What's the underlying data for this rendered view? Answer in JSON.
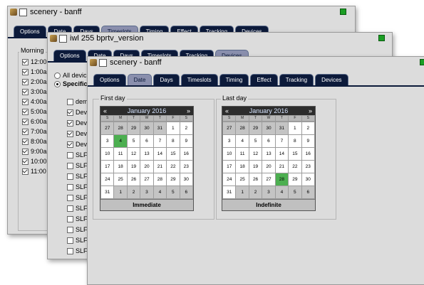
{
  "window1": {
    "title": "scenery - banff",
    "tabs": [
      "Options",
      "Date",
      "Days",
      "Timeslots",
      "Timing",
      "Effect",
      "Tracking",
      "Devices"
    ],
    "active_tab": 3,
    "group_label": "Morning",
    "times": [
      "12:00",
      "1:00a",
      "2:00a",
      "3:00a",
      "4:00a",
      "5:00a",
      "6:00a",
      "7:00a",
      "8:00a",
      "9:00a",
      "10:00",
      "11:00"
    ]
  },
  "window2": {
    "title": "iwl 255 bprtv_version",
    "tabs": [
      "Options",
      "Date",
      "Days",
      "Timeslots",
      "Tracking",
      "Devices"
    ],
    "active_tab": 5,
    "radio_all": "All devic",
    "radio_specific": "Specific",
    "devices": [
      {
        "label": "dem",
        "checked": false
      },
      {
        "label": "Dev",
        "checked": true
      },
      {
        "label": "Dev",
        "checked": true
      },
      {
        "label": "Dev",
        "checked": true
      },
      {
        "label": "Dev",
        "checked": true
      },
      {
        "label": "SLF",
        "checked": false
      },
      {
        "label": "SLF",
        "checked": false
      },
      {
        "label": "SLF",
        "checked": false
      },
      {
        "label": "SLF",
        "checked": false
      },
      {
        "label": "SLF",
        "checked": false
      },
      {
        "label": "SLF",
        "checked": false
      },
      {
        "label": "SLF",
        "checked": false
      },
      {
        "label": "SLF",
        "checked": false
      },
      {
        "label": "SLF",
        "checked": false
      },
      {
        "label": "SLF",
        "checked": false
      }
    ]
  },
  "window3": {
    "title": "scenery - banff",
    "tabs": [
      "Options",
      "Date",
      "Days",
      "Timeslots",
      "Timing",
      "Effect",
      "Tracking",
      "Devices"
    ],
    "active_tab": 1,
    "first_day": {
      "label": "First day",
      "month": "January 2016",
      "prev": "«",
      "next": "»",
      "dow": [
        "S",
        "M",
        "T",
        "W",
        "T",
        "F",
        "S"
      ],
      "days": [
        "27",
        "28",
        "29",
        "30",
        "31",
        "1",
        "2",
        "3",
        "4",
        "5",
        "6",
        "7",
        "8",
        "9",
        "10",
        "11",
        "12",
        "13",
        "14",
        "15",
        "16",
        "17",
        "18",
        "19",
        "20",
        "21",
        "22",
        "23",
        "24",
        "25",
        "26",
        "27",
        "28",
        "29",
        "30",
        "31",
        "1",
        "2",
        "3",
        "4",
        "5",
        "6"
      ],
      "selected_index": 8,
      "footer": "Immediate"
    },
    "last_day": {
      "label": "Last day",
      "month": "January 2016",
      "prev": "«",
      "next": "»",
      "dow": [
        "S",
        "M",
        "T",
        "W",
        "T",
        "F",
        "S"
      ],
      "days": [
        "27",
        "28",
        "29",
        "30",
        "31",
        "1",
        "2",
        "3",
        "4",
        "5",
        "6",
        "7",
        "8",
        "9",
        "10",
        "11",
        "12",
        "13",
        "14",
        "15",
        "16",
        "17",
        "18",
        "19",
        "20",
        "21",
        "22",
        "23",
        "24",
        "25",
        "26",
        "27",
        "28",
        "29",
        "30",
        "31",
        "1",
        "2",
        "3",
        "4",
        "5",
        "6"
      ],
      "selected_index": 32,
      "footer": "Indefinite"
    }
  },
  "colors": {
    "tab_bg": "#0c1a3a",
    "tab_active": "#8a8fad",
    "selected_day": "#4caf50",
    "status_led": "#1b9e24"
  }
}
